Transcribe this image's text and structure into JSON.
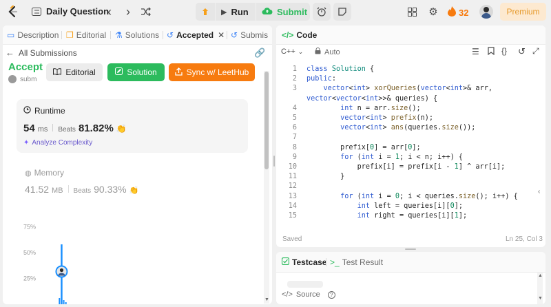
{
  "topbar": {
    "daily_question": "Daily Question",
    "run_label": "Run",
    "submit_label": "Submit",
    "streak_count": "32",
    "premium_label": "Premium"
  },
  "left": {
    "tabs": {
      "description": "Description",
      "editorial": "Editorial",
      "solutions": "Solutions",
      "accepted": "Accepted",
      "submissions": "Submis"
    },
    "all_submissions": "All Submissions",
    "accepted_title": "Accepte",
    "submitted_by": "subm",
    "buttons": {
      "editorial": "Editorial",
      "solution": "Solution",
      "sync": "Sync w/ LeetHub"
    },
    "runtime": {
      "label": "Runtime",
      "value": "54",
      "unit": "ms",
      "beats_label": "Beats",
      "beats_value": "81.82%",
      "analyze": "Analyze Complexity"
    },
    "memory": {
      "label": "Memory",
      "value": "41.52",
      "unit": "MB",
      "beats_label": "Beats",
      "beats_value": "90.33%"
    },
    "chart_ticks": [
      "75%",
      "50%",
      "25%"
    ]
  },
  "chart_data": {
    "type": "bar",
    "ylabel": "",
    "xlabel": "",
    "ylim": [
      0,
      90
    ],
    "y_ticks": [
      "75%",
      "50%",
      "25%"
    ],
    "bars": [
      {
        "x": 0.12,
        "value": 58
      },
      {
        "x": 0.11,
        "value": 6
      },
      {
        "x": 0.13,
        "value": 4
      },
      {
        "x": 0.14,
        "value": 2
      }
    ],
    "highlight_bar_index": 0,
    "grid": false
  },
  "code_panel": {
    "title": "Code",
    "language": "C++",
    "mode": "Auto",
    "status": "Saved",
    "cursor": "Ln 25, Col 3",
    "lines": [
      {
        "n": "1",
        "t": "class Solution {"
      },
      {
        "n": "2",
        "t": "public:"
      },
      {
        "n": "3",
        "t": "    vector<int> xorQueries(vector<int>& arr,"
      },
      {
        "n": "",
        "t": "vector<vector<int>>& queries) {"
      },
      {
        "n": "4",
        "t": "        int n = arr.size();"
      },
      {
        "n": "5",
        "t": "        vector<int> prefix(n);"
      },
      {
        "n": "6",
        "t": "        vector<int> ans(queries.size());"
      },
      {
        "n": "7",
        "t": ""
      },
      {
        "n": "8",
        "t": "        prefix[0] = arr[0];"
      },
      {
        "n": "9",
        "t": "        for (int i = 1; i < n; i++) {"
      },
      {
        "n": "10",
        "t": "            prefix[i] = prefix[i - 1] ^ arr[i];"
      },
      {
        "n": "11",
        "t": "        }"
      },
      {
        "n": "12",
        "t": ""
      },
      {
        "n": "13",
        "t": "        for (int i = 0; i < queries.size(); i++) {"
      },
      {
        "n": "14",
        "t": "            int left = queries[i][0];"
      },
      {
        "n": "15",
        "t": "            int right = queries[i][1];"
      }
    ]
  },
  "testcase": {
    "tab_testcase": "Testcase",
    "tab_result": "Test Result",
    "source": "Source"
  }
}
